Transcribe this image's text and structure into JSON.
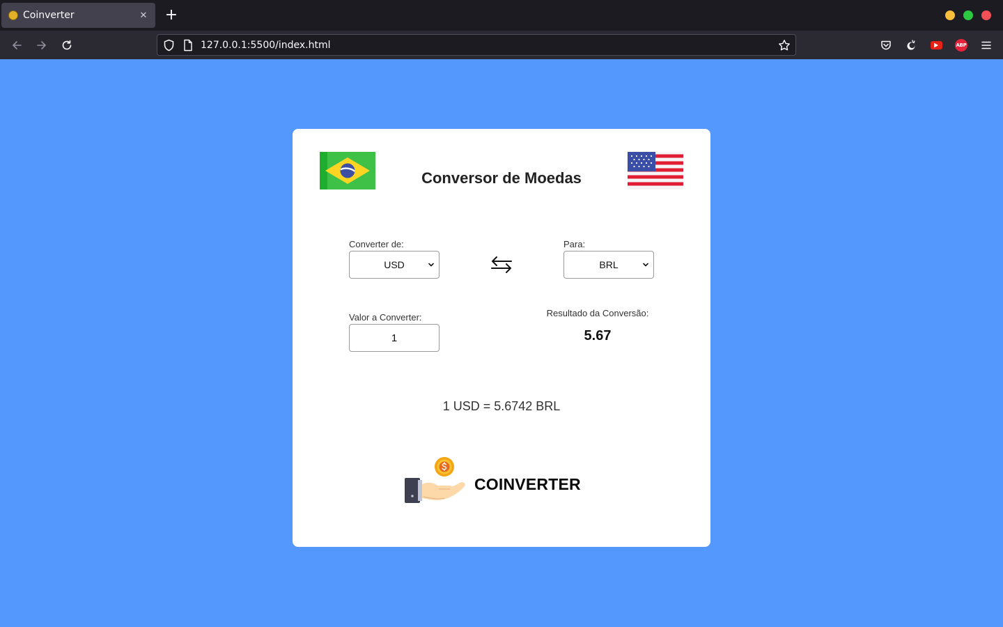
{
  "browser": {
    "tab_title": "Coinverter",
    "tab_close": "✕",
    "new_tab": "+",
    "url": "127.0.0.1:5500/index.html",
    "abp_label": "ABP"
  },
  "page": {
    "title": "Conversor de Moedas",
    "from_label": "Converter de:",
    "from_value": "USD",
    "to_label": "Para:",
    "to_value": "BRL",
    "amount_label": "Valor a Converter:",
    "amount_value": "1",
    "result_label": "Resultado da Conversão:",
    "result_value": "5.67",
    "rate_text": "1 USD = 5.6742 BRL",
    "brand_name": "COINVERTER"
  },
  "colors": {
    "page_background": "#5497fd",
    "card_background": "#ffffff",
    "tabbar_background": "#1c1b22",
    "navbar_background": "#2b2a33"
  }
}
